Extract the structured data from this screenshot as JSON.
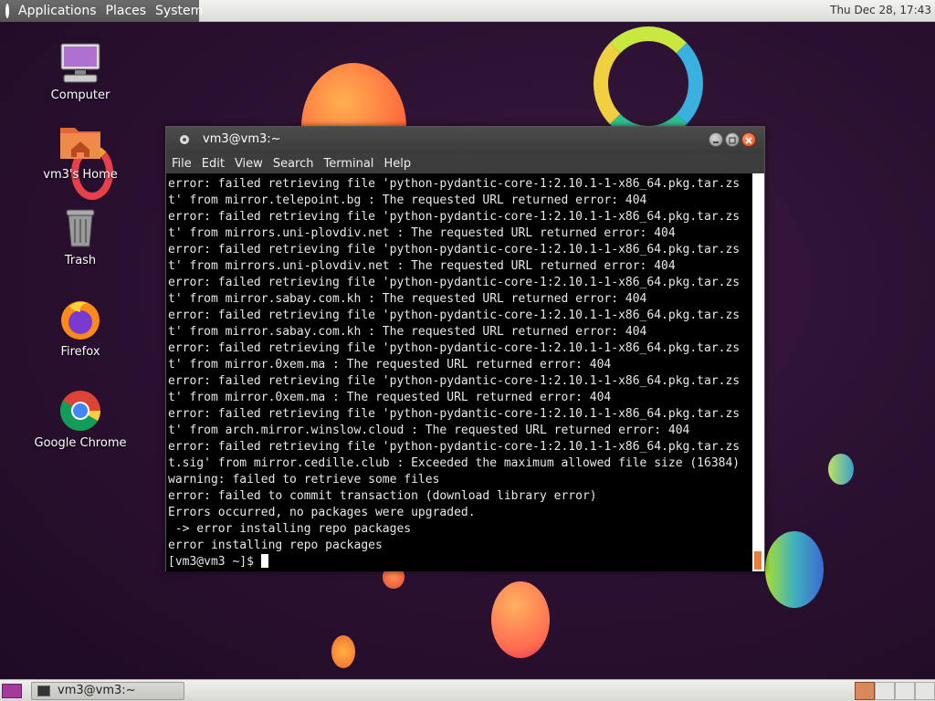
{
  "top_panel": {
    "menus": [
      "Applications",
      "Places",
      "System"
    ],
    "clock": "Thu Dec 28, 17:43"
  },
  "desktop_icons": [
    {
      "label": "Computer"
    },
    {
      "label": "vm3's Home"
    },
    {
      "label": "Trash"
    },
    {
      "label": "Firefox"
    },
    {
      "label": "Google Chrome"
    }
  ],
  "terminal": {
    "title": "vm3@vm3:~",
    "menu": [
      "File",
      "Edit",
      "View",
      "Search",
      "Terminal",
      "Help"
    ],
    "lines": [
      "error: failed retrieving file 'python-pydantic-core-1:2.10.1-1-x86_64.pkg.tar.zs",
      "t' from mirror.telepoint.bg : The requested URL returned error: 404",
      "error: failed retrieving file 'python-pydantic-core-1:2.10.1-1-x86_64.pkg.tar.zs",
      "t' from mirrors.uni-plovdiv.net : The requested URL returned error: 404",
      "error: failed retrieving file 'python-pydantic-core-1:2.10.1-1-x86_64.pkg.tar.zs",
      "t' from mirrors.uni-plovdiv.net : The requested URL returned error: 404",
      "error: failed retrieving file 'python-pydantic-core-1:2.10.1-1-x86_64.pkg.tar.zs",
      "t' from mirror.sabay.com.kh : The requested URL returned error: 404",
      "error: failed retrieving file 'python-pydantic-core-1:2.10.1-1-x86_64.pkg.tar.zs",
      "t' from mirror.sabay.com.kh : The requested URL returned error: 404",
      "error: failed retrieving file 'python-pydantic-core-1:2.10.1-1-x86_64.pkg.tar.zs",
      "t' from mirror.0xem.ma : The requested URL returned error: 404",
      "error: failed retrieving file 'python-pydantic-core-1:2.10.1-1-x86_64.pkg.tar.zs",
      "t' from mirror.0xem.ma : The requested URL returned error: 404",
      "error: failed retrieving file 'python-pydantic-core-1:2.10.1-1-x86_64.pkg.tar.zs",
      "t' from arch.mirror.winslow.cloud : The requested URL returned error: 404",
      "error: failed retrieving file 'python-pydantic-core-1:2.10.1-1-x86_64.pkg.tar.zs",
      "t.sig' from mirror.cedille.club : Exceeded the maximum allowed file size (16384)",
      "warning: failed to retrieve some files",
      "error: failed to commit transaction (download library error)",
      "Errors occurred, no packages were upgraded.",
      " -> error installing repo packages",
      "error installing repo packages"
    ],
    "prompt": "[vm3@vm3 ~]$ "
  },
  "taskbar": {
    "window_button": "vm3@vm3:~"
  },
  "colors": {
    "desktop_bg": "#2a1231",
    "scroll_thumb": "#e87d3e",
    "active_workspace": "#d9885a"
  }
}
